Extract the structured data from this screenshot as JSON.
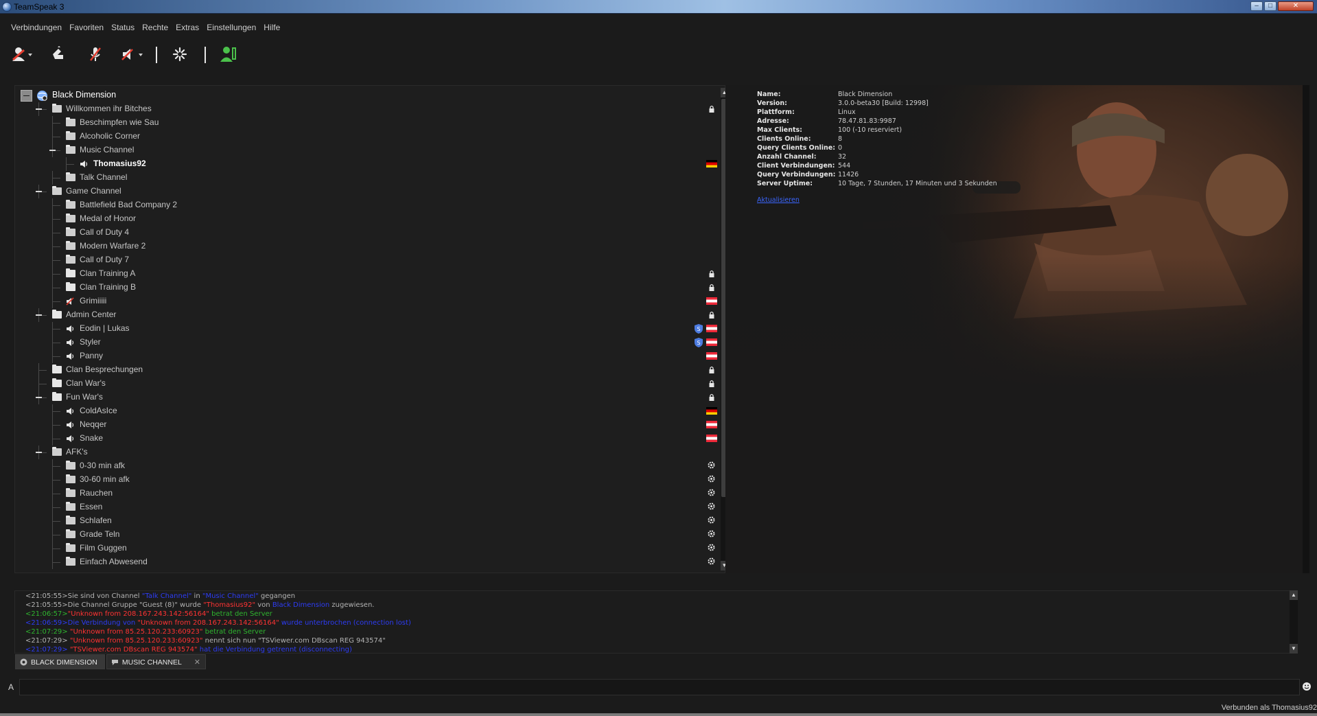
{
  "window": {
    "title": "TeamSpeak 3",
    "min_label": "–",
    "max_label": "□",
    "close_label": "✕"
  },
  "menu": [
    "Verbindungen",
    "Favoriten",
    "Status",
    "Rechte",
    "Extras",
    "Einstellungen",
    "Hilfe"
  ],
  "toolbar": {
    "icons": [
      "connect-icon",
      "away-icon",
      "mute-microphone-icon",
      "mute-speakers-icon",
      "activate-microphone-icon",
      "contacts-icon"
    ]
  },
  "tree": {
    "server": "Black Dimension",
    "rows": [
      {
        "label": "Willkommen ihr Bitches",
        "type": "channel",
        "level": 1
      },
      {
        "label": "Beschimpfen wie Sau",
        "type": "channel",
        "level": 2
      },
      {
        "label": "Alcoholic Corner",
        "type": "channel",
        "level": 2
      },
      {
        "label": "Music Channel",
        "type": "channel",
        "level": 2
      },
      {
        "label": "Thomasius92",
        "type": "user",
        "level": 3
      },
      {
        "label": "Talk Channel",
        "type": "channel",
        "level": 2
      },
      {
        "label": "Game Channel",
        "type": "channel",
        "level": 1
      },
      {
        "label": "Battlefield Bad Company 2",
        "type": "channel",
        "level": 2
      },
      {
        "label": "Medal of Honor",
        "type": "channel",
        "level": 2
      },
      {
        "label": "Call of Duty 4",
        "type": "channel",
        "level": 2
      },
      {
        "label": "Modern Warfare 2",
        "type": "channel",
        "level": 2
      },
      {
        "label": "Call of Duty 7",
        "type": "channel",
        "level": 2
      },
      {
        "label": "Clan Training A",
        "type": "channel",
        "level": 2
      },
      {
        "label": "Clan Training B",
        "type": "channel",
        "level": 2
      },
      {
        "label": "Grimiiiii",
        "type": "user",
        "level": 2
      },
      {
        "label": "Admin Center",
        "type": "channel",
        "level": 1
      },
      {
        "label": "Eodin | Lukas",
        "type": "user",
        "level": 2
      },
      {
        "label": "Styler",
        "type": "user",
        "level": 2
      },
      {
        "label": "Panny",
        "type": "user",
        "level": 2
      },
      {
        "label": "Clan Besprechungen",
        "type": "channel",
        "level": 1
      },
      {
        "label": "Clan War's",
        "type": "channel",
        "level": 1
      },
      {
        "label": "Fun War's",
        "type": "channel",
        "level": 1
      },
      {
        "label": "ColdAsIce",
        "type": "user",
        "level": 2
      },
      {
        "label": "Neqqer",
        "type": "user",
        "level": 2
      },
      {
        "label": "Snake",
        "type": "user",
        "level": 2
      },
      {
        "label": "AFK's",
        "type": "channel",
        "level": 1
      },
      {
        "label": "0-30 min afk",
        "type": "channel",
        "level": 2
      },
      {
        "label": "30-60 min afk",
        "type": "channel",
        "level": 2
      },
      {
        "label": "Rauchen",
        "type": "channel",
        "level": 2
      },
      {
        "label": "Essen",
        "type": "channel",
        "level": 2
      },
      {
        "label": "Schlafen",
        "type": "channel",
        "level": 2
      },
      {
        "label": "Grade Teln",
        "type": "channel",
        "level": 2
      },
      {
        "label": "Film Guggen",
        "type": "channel",
        "level": 2
      },
      {
        "label": "Einfach Abwesend",
        "type": "channel",
        "level": 2
      }
    ]
  },
  "server_info": {
    "rows": [
      {
        "key": "Name:",
        "value": "Black Dimension"
      },
      {
        "key": "Version:",
        "value": "3.0.0-beta30 [Build: 12998]"
      },
      {
        "key": "Plattform:",
        "value": "Linux"
      },
      {
        "key": "Adresse:",
        "value": "78.47.81.83:9987"
      },
      {
        "key": "Max Clients:",
        "value": "100 (-10 reserviert)"
      },
      {
        "key": "Clients Online:",
        "value": "8"
      },
      {
        "key": "Query Clients Online:",
        "value": "0"
      },
      {
        "key": "Anzahl Channel:",
        "value": "32"
      },
      {
        "key": "Client Verbindungen:",
        "value": "544"
      },
      {
        "key": "Query Verbindungen:",
        "value": "11426"
      },
      {
        "key": "Server Uptime:",
        "value": "10 Tage, 7 Stunden, 17 Minuten und 3 Sekunden"
      }
    ],
    "link": "Aktualisieren"
  },
  "log": [
    [
      {
        "t": "<21:05:55>Sie sind von Channel ",
        "c": "c-grey"
      },
      {
        "t": "\"Talk Channel\"",
        "c": "c-blue"
      },
      {
        "t": " in ",
        "c": "c-grey"
      },
      {
        "t": "\"Music Channel\"",
        "c": "c-blue"
      },
      {
        "t": " gegangen",
        "c": "c-grey"
      }
    ],
    [
      {
        "t": "<21:05:55>Die Channel Gruppe \"Guest (8)\" wurde ",
        "c": "c-grey"
      },
      {
        "t": "\"Thomasius92\"",
        "c": "c-red"
      },
      {
        "t": " von ",
        "c": "c-grey"
      },
      {
        "t": "Black Dimension",
        "c": "c-blue"
      },
      {
        "t": " zugewiesen.",
        "c": "c-grey"
      }
    ],
    [
      {
        "t": "<21:06:57>",
        "c": "c-green"
      },
      {
        "t": "\"Unknown from 208.167.243.142:56164\"",
        "c": "c-red"
      },
      {
        "t": " betrat den Server",
        "c": "c-green"
      }
    ],
    [
      {
        "t": "<21:06:59>Die Verbindung von ",
        "c": "c-blue"
      },
      {
        "t": "\"Unknown from 208.167.243.142:56164\"",
        "c": "c-red"
      },
      {
        "t": " wurde unterbrochen (connection lost)",
        "c": "c-blue"
      }
    ],
    [
      {
        "t": "<21:07:29> ",
        "c": "c-green"
      },
      {
        "t": "\"Unknown from 85.25.120.233:60923\"",
        "c": "c-red"
      },
      {
        "t": " betrat den Server",
        "c": "c-green"
      }
    ],
    [
      {
        "t": "<21:07:29> ",
        "c": "c-grey"
      },
      {
        "t": "\"Unknown from 85.25.120.233:60923\"",
        "c": "c-red"
      },
      {
        "t": " nennt sich nun \"TSViewer.com DBscan REG 943574\"",
        "c": "c-grey"
      }
    ],
    [
      {
        "t": "<21:07:29> ",
        "c": "c-blue"
      },
      {
        "t": "\"TSViewer.com DBscan REG 943574\"",
        "c": "c-red"
      },
      {
        "t": " hat die Verbindung getrennt (disconnecting)",
        "c": "c-blue"
      }
    ]
  ],
  "tabs": [
    {
      "label": "Black Dimension"
    },
    {
      "label": "Music Channel"
    }
  ],
  "input": {
    "label": "A",
    "placeholder": ""
  },
  "status": {
    "text": "Verbunden als Thomasius92"
  }
}
